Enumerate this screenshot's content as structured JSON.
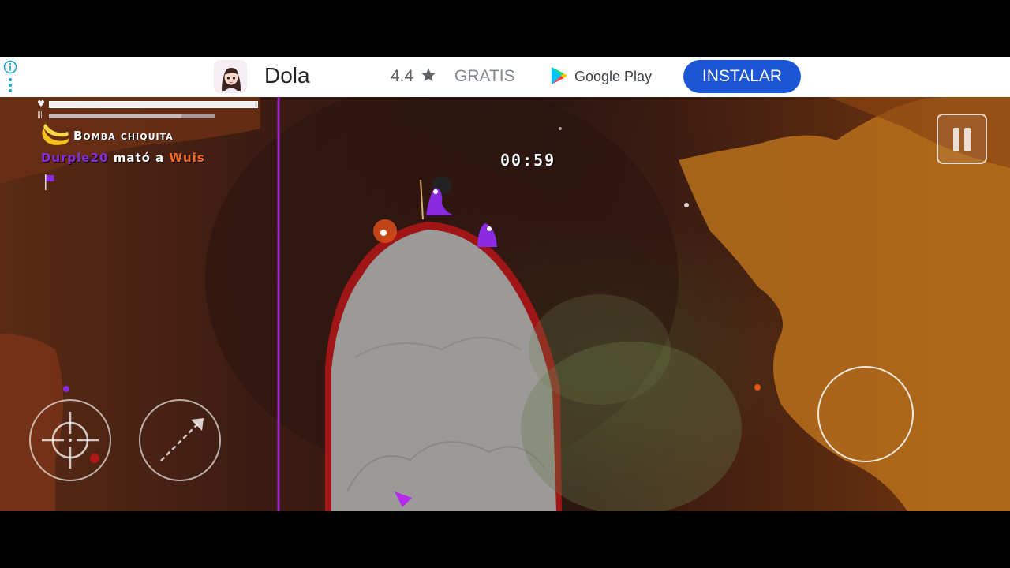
{
  "ad": {
    "app_name": "Dola",
    "rating": "4.4",
    "price": "GRATIS",
    "store": "Google Play",
    "install_label": "INSTALAR"
  },
  "hud": {
    "health_fraction": 0.99,
    "ammo_fraction": 0.8,
    "weapon_name": "Bomba chiquita",
    "kill_feed": {
      "killer": "Durple20",
      "verb": "mató a",
      "victim": "Wuis"
    },
    "timer": "00:59"
  },
  "colors": {
    "install_button": "#1a56d6",
    "killer": "#8a2be2",
    "victim": "#ff6a1a",
    "rock_rim": "#a01515"
  },
  "icons": [
    "info-icon",
    "more-vert-icon",
    "star-icon",
    "google-play-icon",
    "heart-icon",
    "banana-bomb-icon",
    "flag-icon",
    "pause-icon",
    "crosshair-icon",
    "arrow-icon"
  ]
}
